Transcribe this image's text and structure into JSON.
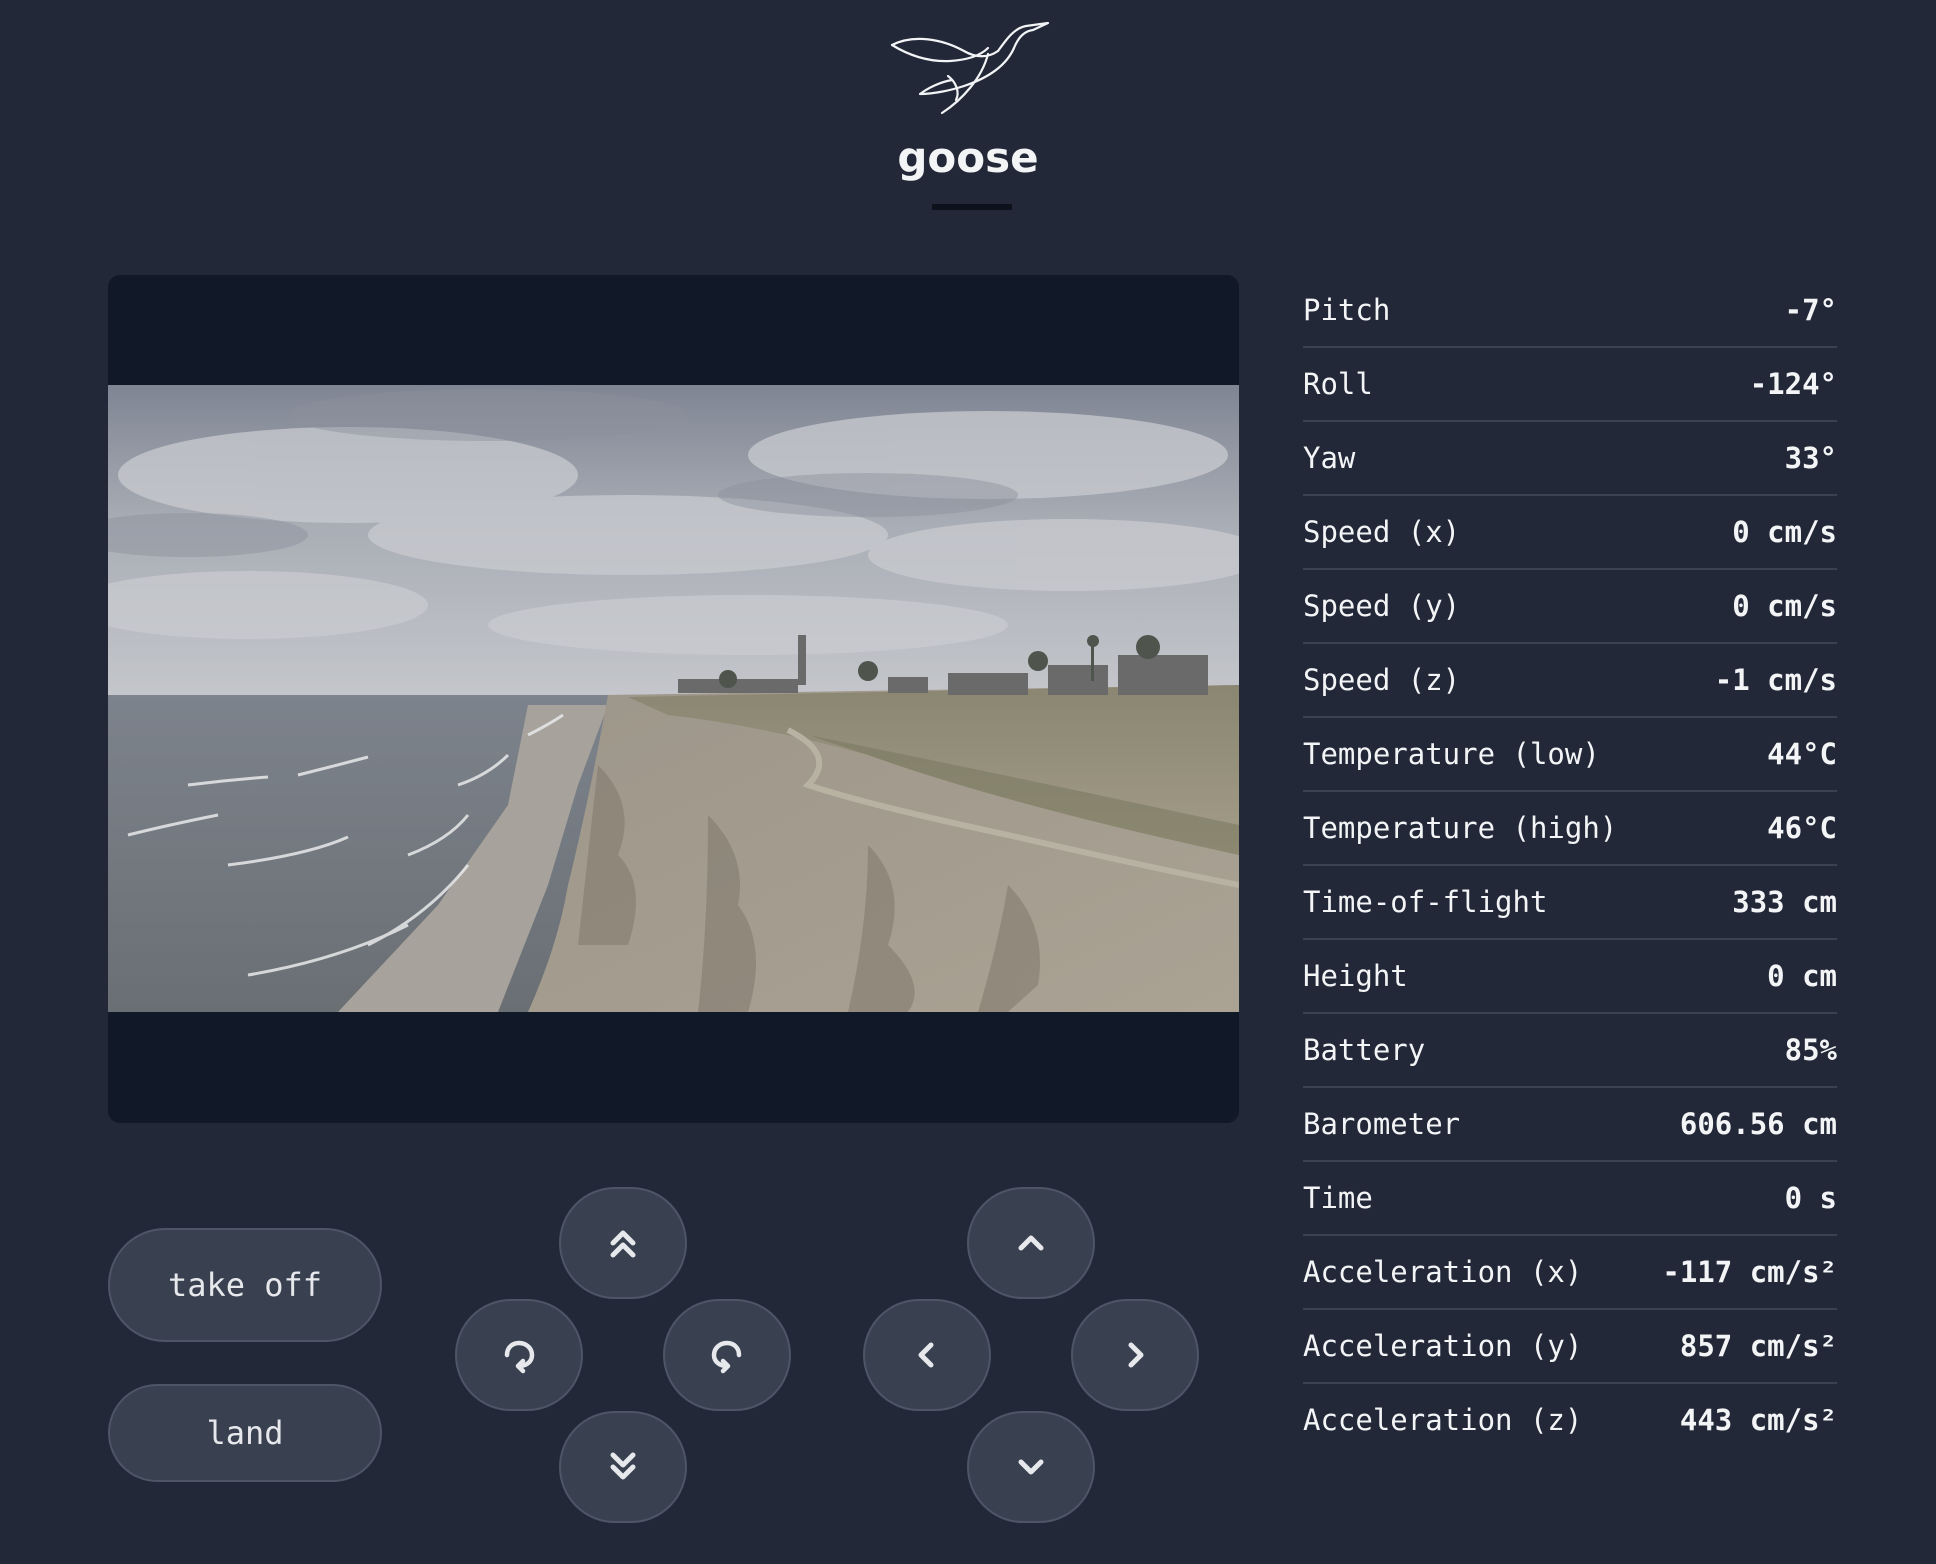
{
  "header": {
    "logo_icon": "goose-logo-icon",
    "title": "goose"
  },
  "video": {
    "feed_icon": "drone-camera-feed",
    "description_colors": {
      "panel_bg": "#111827"
    }
  },
  "telemetry": [
    {
      "label": "Pitch",
      "value": "-7°"
    },
    {
      "label": "Roll",
      "value": "-124°"
    },
    {
      "label": "Yaw",
      "value": "33°"
    },
    {
      "label": "Speed (x)",
      "value": "0 cm/s"
    },
    {
      "label": "Speed (y)",
      "value": "0 cm/s"
    },
    {
      "label": "Speed (z)",
      "value": "-1 cm/s"
    },
    {
      "label": "Temperature (low)",
      "value": "44°C"
    },
    {
      "label": "Temperature (high)",
      "value": "46°C"
    },
    {
      "label": "Time-of-flight",
      "value": "333 cm"
    },
    {
      "label": "Height",
      "value": "0 cm"
    },
    {
      "label": "Battery",
      "value": "85%"
    },
    {
      "label": "Barometer",
      "value": "606.56 cm"
    },
    {
      "label": "Time",
      "value": "0 s"
    },
    {
      "label": "Acceleration (x)",
      "value": "-117 cm/s²"
    },
    {
      "label": "Acceleration (y)",
      "value": "857 cm/s²"
    },
    {
      "label": "Acceleration (z)",
      "value": "443 cm/s²"
    }
  ],
  "actions": {
    "take_off": "take off",
    "land": "land"
  },
  "controls": {
    "altitude": {
      "up_icon": "double-chevron-up-icon",
      "down_icon": "double-chevron-down-icon",
      "rotate_ccw_icon": "rotate-counterclockwise-icon",
      "rotate_cw_icon": "rotate-clockwise-icon"
    },
    "movement": {
      "forward_icon": "chevron-up-icon",
      "back_icon": "chevron-down-icon",
      "left_icon": "chevron-left-icon",
      "right_icon": "chevron-right-icon"
    }
  },
  "colors": {
    "background": "#222838",
    "button_bg": "#394151",
    "button_border": "#4d5566",
    "divider": "#3a4151",
    "text": "#f3f4f6"
  }
}
